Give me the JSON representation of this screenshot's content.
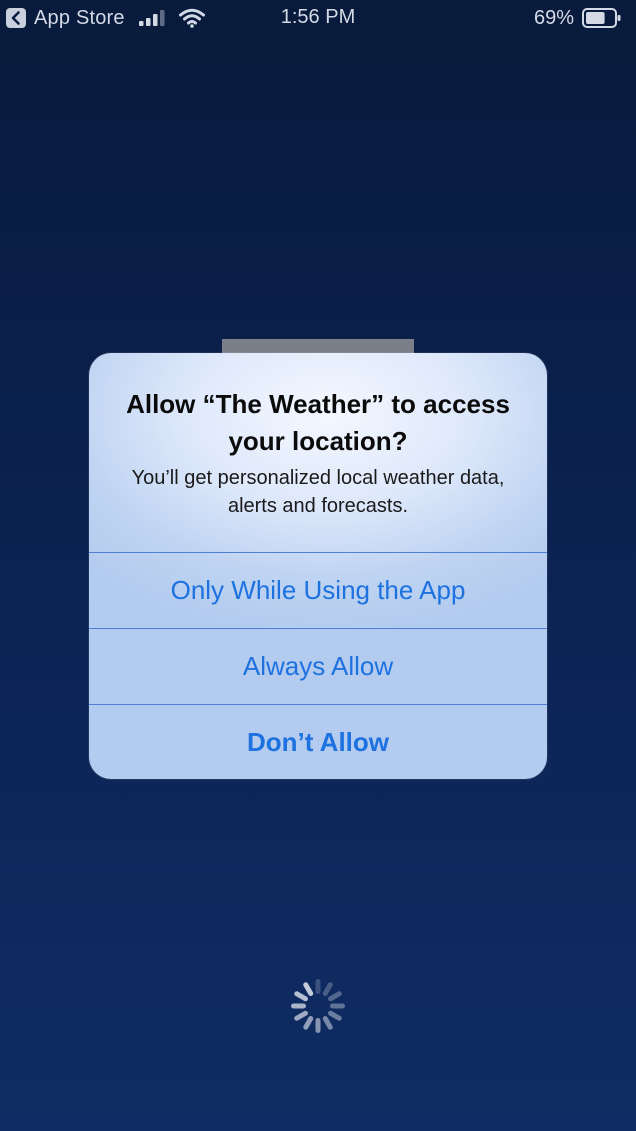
{
  "status_bar": {
    "back_label": "App Store",
    "time": "1:56 PM",
    "battery_percent_label": "69%",
    "battery_level": 0.69,
    "signal_bars_filled": 3,
    "signal_bars_total": 4,
    "icons": {
      "back": "back-chevron-icon",
      "signal": "cellular-signal-icon",
      "wifi": "wifi-icon",
      "battery": "battery-icon"
    }
  },
  "alert": {
    "title": "Allow “The Weather” to access your location?",
    "message": "You’ll get personalized local weather data, alerts and forecasts.",
    "buttons": [
      {
        "label": "Only While Using the App"
      },
      {
        "label": "Always Allow"
      },
      {
        "label": "Don’t Allow"
      }
    ]
  },
  "colors": {
    "accent": "#1d72e0",
    "background_top": "#081b3c",
    "background_bottom": "#0f2d64"
  }
}
